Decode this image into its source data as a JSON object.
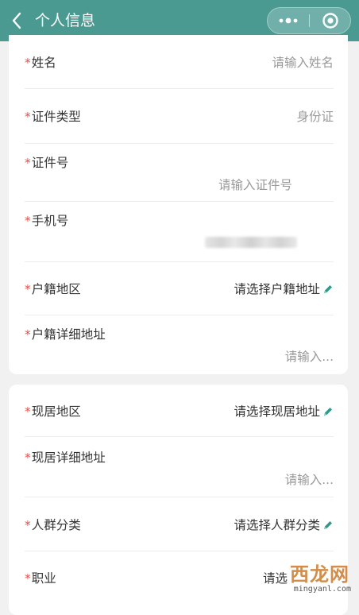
{
  "header": {
    "title": "个人信息",
    "back_icon": "chevron-left-icon",
    "more_icon": "more-dots-icon",
    "close_icon": "target-close-icon",
    "bg_color": "#4a9a92"
  },
  "colors": {
    "required": "#e0504a",
    "placeholder": "#9a9a9a",
    "text": "#333333",
    "pencil": "#2e9a8a"
  },
  "required_mark": "*",
  "section1": [
    {
      "label": "姓名",
      "placeholder": "请输入姓名"
    },
    {
      "label": "证件类型",
      "value": "身份证"
    },
    {
      "label": "证件号",
      "placeholder": "请输入证件号"
    },
    {
      "label": "手机号",
      "value": ""
    },
    {
      "label": "户籍地区",
      "value": "请选择户籍地址"
    },
    {
      "label": "户籍详细地址",
      "placeholder": "请输入..."
    }
  ],
  "section2": [
    {
      "label": "现居地区",
      "value": "请选择现居地址"
    },
    {
      "label": "现居详细地址",
      "placeholder": "请输入..."
    },
    {
      "label": "人群分类",
      "value": "请选择人群分类"
    },
    {
      "label": "职业",
      "value": "请选"
    }
  ],
  "watermark": {
    "logo": "西龙网",
    "url": "mingyanl.com"
  }
}
